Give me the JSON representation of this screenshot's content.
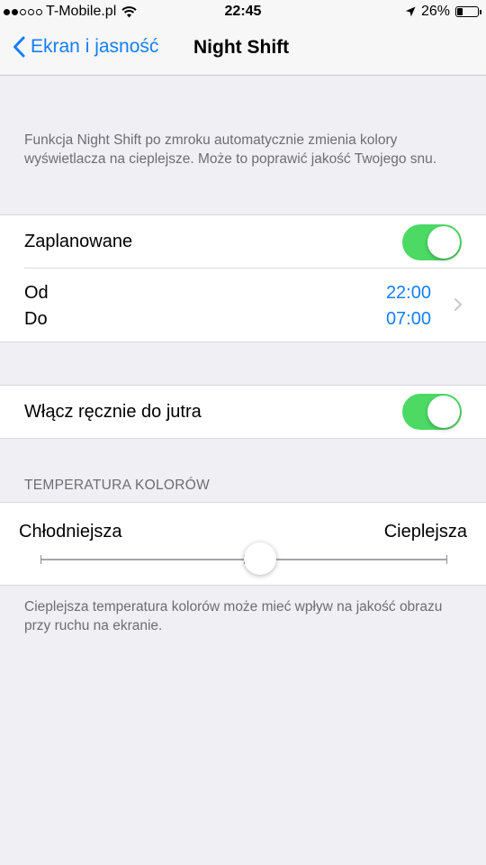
{
  "status_bar": {
    "carrier": "T-Mobile.pl",
    "time": "22:45",
    "battery": "26%",
    "signal_filled": 2,
    "signal_total": 5
  },
  "nav": {
    "back_label": "Ekran i jasność",
    "title": "Night Shift"
  },
  "intro_text": "Funkcja Night Shift po zmroku automatycznie zmienia kolory wyświetlacza na cieplejsze. Może to poprawić jakość Twojego snu.",
  "scheduled": {
    "label": "Zaplanowane",
    "enabled": true
  },
  "schedule": {
    "from_label": "Od",
    "from_value": "22:00",
    "to_label": "Do",
    "to_value": "07:00"
  },
  "manual": {
    "label": "Włącz ręcznie do jutra",
    "enabled": true
  },
  "temperature": {
    "header": "TEMPERATURA KOLORÓW",
    "cold_label": "Chłodniejsza",
    "warm_label": "Cieplejsza",
    "level": 0.54
  },
  "footer_text": "Cieplejsza temperatura kolorów może mieć wpływ na jakość obrazu przy ruchu na ekranie.",
  "colors": {
    "accent": "#157efb",
    "toggle_on": "#4cd964",
    "background": "#efeff4"
  }
}
